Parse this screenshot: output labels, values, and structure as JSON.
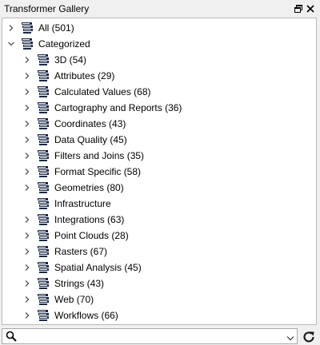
{
  "window": {
    "title": "Transformer Gallery",
    "restore_icon": "restore-window-icon",
    "close_icon": "close-icon"
  },
  "tree": {
    "root_items": [
      {
        "label": "All (501)",
        "expanded": false,
        "icon": "transformer-stack-icon"
      },
      {
        "label": "Categorized",
        "expanded": true,
        "icon": "transformer-stack-icon"
      }
    ],
    "categories": [
      {
        "label": "3D (54)",
        "has_children": true
      },
      {
        "label": "Attributes (29)",
        "has_children": true
      },
      {
        "label": "Calculated Values (68)",
        "has_children": true
      },
      {
        "label": "Cartography and Reports (36)",
        "has_children": true
      },
      {
        "label": "Coordinates (43)",
        "has_children": true
      },
      {
        "label": "Data Quality (45)",
        "has_children": true
      },
      {
        "label": "Filters and Joins (35)",
        "has_children": true
      },
      {
        "label": "Format Specific (58)",
        "has_children": true
      },
      {
        "label": "Geometries (80)",
        "has_children": true
      },
      {
        "label": "Infrastructure",
        "has_children": false
      },
      {
        "label": "Integrations (63)",
        "has_children": true
      },
      {
        "label": "Point Clouds (28)",
        "has_children": true
      },
      {
        "label": "Rasters (67)",
        "has_children": true
      },
      {
        "label": "Spatial Analysis (45)",
        "has_children": true
      },
      {
        "label": "Strings (43)",
        "has_children": true
      },
      {
        "label": "Web (70)",
        "has_children": true
      },
      {
        "label": "Workflows (66)",
        "has_children": true
      }
    ]
  },
  "search": {
    "value": "",
    "placeholder": "",
    "icon": "search-icon",
    "dropdown_icon": "chevron-down-icon"
  },
  "refresh": {
    "icon": "refresh-icon"
  },
  "colors": {
    "icon_dark": "#1b2a45",
    "chevron": "#555555",
    "panel_bg": "#f0f0f0"
  }
}
